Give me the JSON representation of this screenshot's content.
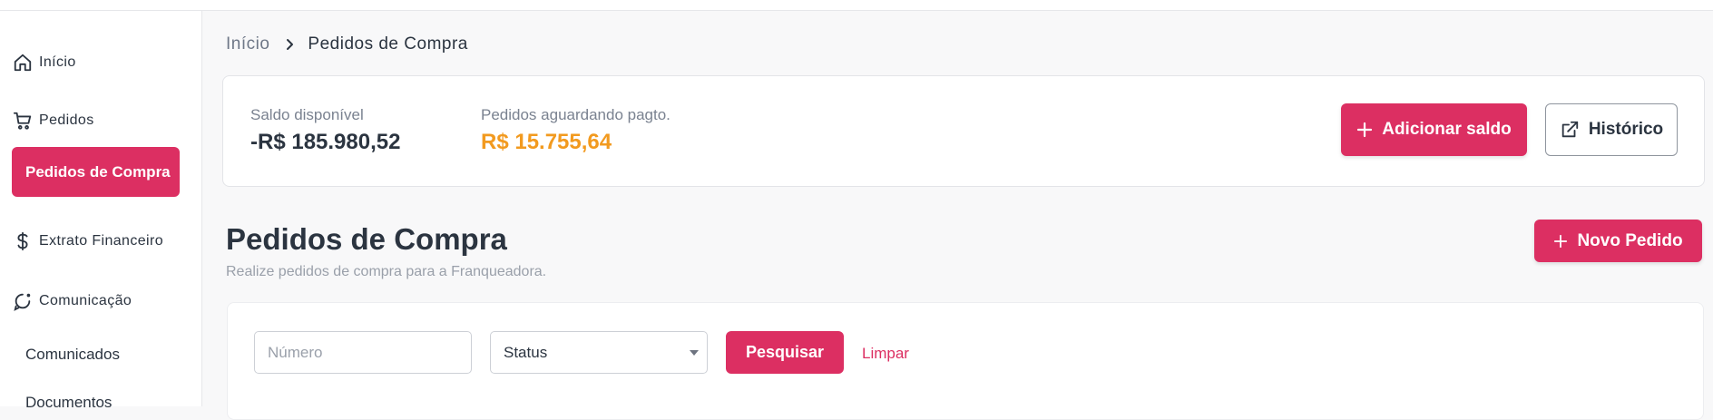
{
  "sidebar": {
    "items": [
      {
        "label": "Início",
        "icon": "home-icon"
      },
      {
        "label": "Pedidos",
        "icon": "cart-icon"
      },
      {
        "label": "Pedidos de Compra",
        "active": true
      },
      {
        "label": "Extrato Financeiro",
        "icon": "dollar-icon"
      },
      {
        "label": "Comunicação",
        "icon": "chat-icon"
      },
      {
        "label": "Comunicados"
      },
      {
        "label": "Documentos"
      }
    ]
  },
  "breadcrumb": {
    "home": "Início",
    "separator_icon": "chevron-right-icon",
    "current": "Pedidos de Compra"
  },
  "balance": {
    "available_label": "Saldo disponível",
    "available_value": "-R$ 185.980,52",
    "pending_label": "Pedidos aguardando pagto.",
    "pending_value": "R$ 15.755,64",
    "add_button": "Adicionar saldo",
    "history_button": "Histórico"
  },
  "page": {
    "title": "Pedidos de Compra",
    "subtitle": "Realize pedidos de compra para a Franqueadora.",
    "new_order_button": "Novo Pedido"
  },
  "filters": {
    "number_placeholder": "Número",
    "status_value": "Status",
    "search_button": "Pesquisar",
    "clear_link": "Limpar"
  },
  "colors": {
    "accent": "#dc2f62",
    "pending": "#f29a1f",
    "text_dark": "#2b3440"
  }
}
